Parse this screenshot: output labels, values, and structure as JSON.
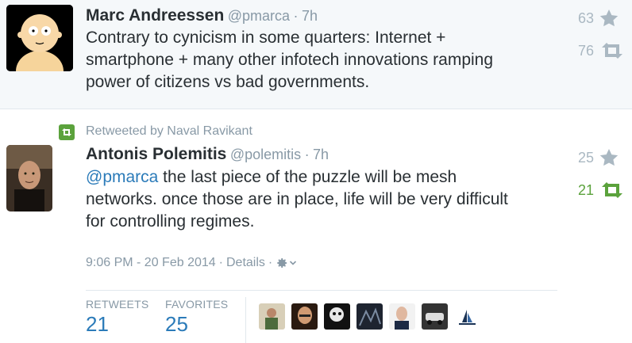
{
  "tweet1": {
    "name": "Marc Andreessen",
    "handle": "@pmarca",
    "separator": "·",
    "time": "7h",
    "text_lines": [
      "Contrary to cynicism in some quarters: Internet +",
      "smartphone + many other infotech innovations ramping",
      "power of citizens vs bad governments."
    ],
    "favorites": "63",
    "retweets": "76"
  },
  "tweet2": {
    "retweeted_by": "Retweeted by Naval Ravikant",
    "name": "Antonis Polemitis",
    "handle": "@polemitis",
    "separator": "·",
    "time": "7h",
    "mention": "@pmarca",
    "text_first_rest": " the last piece of the puzzle will be mesh",
    "text_lines": [
      "networks.  once those are in place, life will be very difficult",
      "for controlling regimes."
    ],
    "favorites": "25",
    "retweets": "21",
    "timestamp": "9:06 PM - 20 Feb 2014",
    "meta_sep": "·",
    "details_label": "Details",
    "retweets_label": "RETWEETS",
    "retweets_count": "21",
    "favorites_label": "FAVORITES",
    "favorites_count": "25"
  },
  "colors": {
    "link": "#2b7bb9",
    "muted": "#8899a6",
    "retweet_green": "#5ba23c",
    "icon_gray": "#aab8c2"
  },
  "icons": [
    "star-icon",
    "retweet-icon",
    "retweeted-badge-icon",
    "gear-icon",
    "chevron-down-icon"
  ]
}
